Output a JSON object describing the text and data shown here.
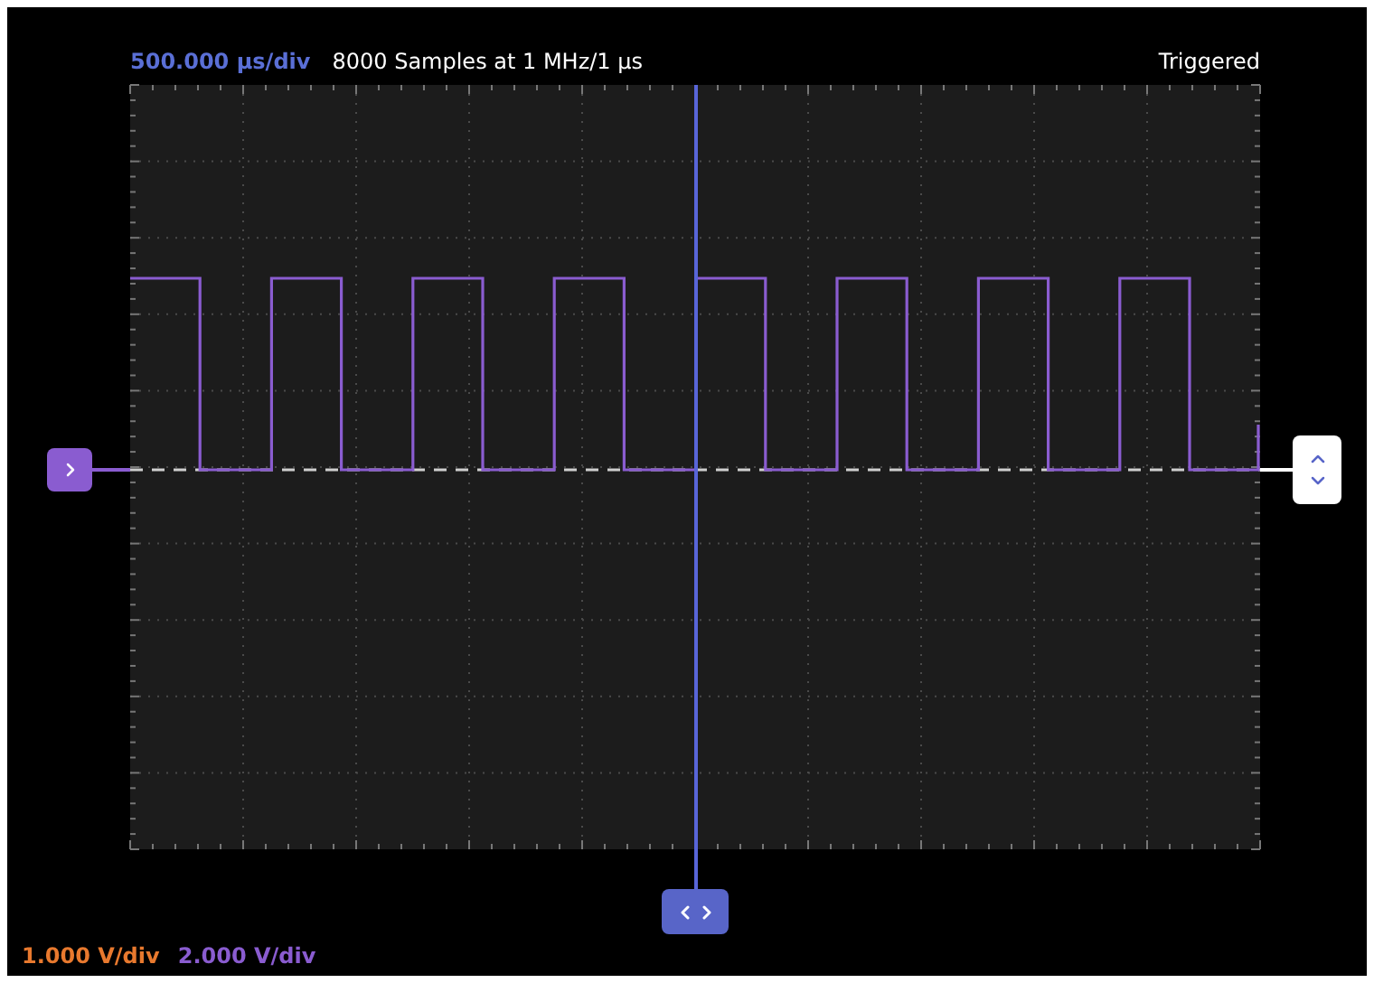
{
  "header": {
    "timebase": "500.000 µs/div",
    "acquisition": "8000 Samples at 1 MHz/1 µs",
    "status": "Triggered"
  },
  "channels": [
    {
      "scale": "1.000 V/div",
      "color": "#e8792e"
    },
    {
      "scale": "2.000 V/div",
      "color": "#8a5cd0"
    }
  ]
}
